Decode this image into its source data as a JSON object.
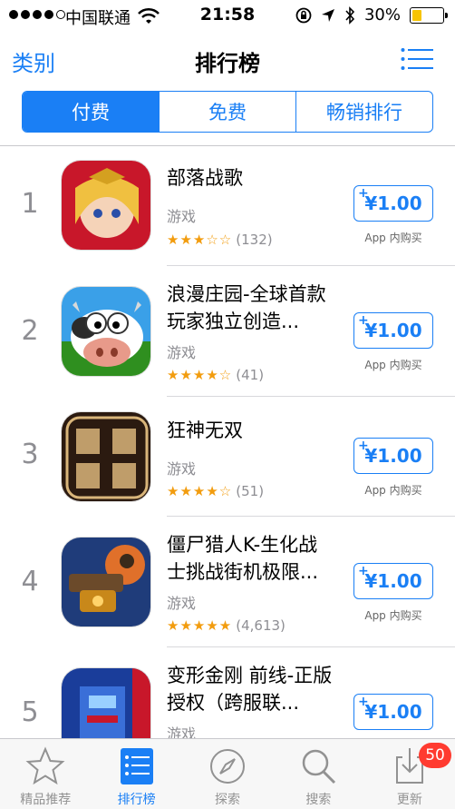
{
  "status_bar": {
    "carrier": "中国联通",
    "time": "21:58",
    "battery_percent": "30%",
    "battery_level": 0.3
  },
  "nav": {
    "left_label": "类别",
    "title": "排行榜",
    "right_icon": "list-icon"
  },
  "segments": [
    {
      "label": "付费",
      "active": true
    },
    {
      "label": "免费",
      "active": false
    },
    {
      "label": "畅销排行",
      "active": false
    }
  ],
  "apps": [
    {
      "rank": "1",
      "name": "部落战歌",
      "category": "游戏",
      "stars": "★★★☆☆",
      "rating_value": 3,
      "count": "(132)",
      "price": "¥1.00",
      "iap": "App 内购买",
      "icon_colors": [
        "#c8172a",
        "#f0c040"
      ]
    },
    {
      "rank": "2",
      "name": "浪漫庄园-全球首款玩家独立创造...",
      "category": "游戏",
      "stars": "★★★★☆",
      "rating_value": 4,
      "count": "(41)",
      "price": "¥1.00",
      "iap": "App 内购买",
      "icon_colors": [
        "#3aa0e8",
        "#2f8f1f"
      ]
    },
    {
      "rank": "3",
      "name": "狂神无双",
      "category": "游戏",
      "stars": "★★★★☆",
      "rating_value": 4,
      "count": "(51)",
      "price": "¥1.00",
      "iap": "App 内购买",
      "icon_colors": [
        "#2b1a10",
        "#d9b57a"
      ]
    },
    {
      "rank": "4",
      "name": "僵尸猎人K-生化战士挑战街机极限...",
      "category": "游戏",
      "stars": "★★★★★",
      "rating_value": 5,
      "count": "(4,613)",
      "price": "¥1.00",
      "iap": "App 内购买",
      "icon_colors": [
        "#1f3c7a",
        "#e0702a"
      ]
    },
    {
      "rank": "5",
      "name": "变形金刚 前线-正版授权（跨服联...",
      "category": "游戏",
      "stars": "",
      "rating_value": null,
      "count": "",
      "price": "¥1.00",
      "iap": "",
      "icon_colors": [
        "#1a3d9a",
        "#c8172a"
      ]
    }
  ],
  "tabs": [
    {
      "label": "精品推荐",
      "icon": "star-icon",
      "active": false
    },
    {
      "label": "排行榜",
      "icon": "ranking-list-icon",
      "active": true
    },
    {
      "label": "探索",
      "icon": "compass-icon",
      "active": false
    },
    {
      "label": "搜索",
      "icon": "search-icon",
      "active": false
    },
    {
      "label": "更新",
      "icon": "update-download-icon",
      "active": false,
      "badge": "50"
    }
  ],
  "colors": {
    "accent": "#1a7ff5",
    "star": "#f29c0e",
    "badge": "#ff3b30",
    "battery": "#f7c400"
  }
}
